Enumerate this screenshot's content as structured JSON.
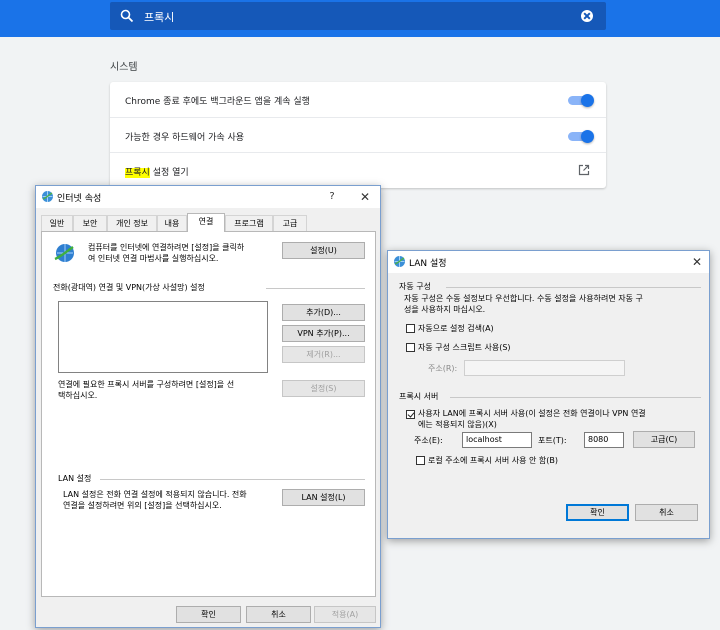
{
  "chrome": {
    "search_value": "프록시",
    "section_title": "시스템",
    "rows": [
      {
        "label": "Chrome 종료 후에도 백그라운드 앱을 계속 실행",
        "enabled": true
      },
      {
        "label": "가능한 경우 하드웨어 가속 사용",
        "enabled": true
      }
    ],
    "proxy_highlight": "프록시",
    "proxy_rest": " 설정 열기",
    "accent": "#1a73e8"
  },
  "inet": {
    "title": "인터넷 속성",
    "help": "?",
    "close": "✕",
    "tabs": [
      "일반",
      "보안",
      "개인 정보",
      "내용",
      "연결",
      "프로그램",
      "고급"
    ],
    "active_tab": "연결",
    "setup_text_1": "컴퓨터를 인터넷에 연결하려면 [설정]을 클릭하",
    "setup_text_2": "여 인터넷 연결 마법사를 실행하십시오.",
    "setup_button": "설정(U)",
    "dialup_header": "전화(광대역) 연결 및 VPN(가상 사설망) 설정",
    "add_button": "추가(D)...",
    "vpn_add_button": "VPN 추가(P)...",
    "remove_button": "제거(R)...",
    "proxy_text_1": "연결에 필요한 프록시 서버를 구성하려면 [설정]을 선",
    "proxy_text_2": "택하십시오.",
    "settings_button": "설정(S)",
    "lan_header": "LAN 설정",
    "lan_text_1": "LAN 설정은 전화 연결 설정에 적용되지 않습니다. 전화",
    "lan_text_2": "연결을 설정하려면 위의 [설정]을 선택하십시오.",
    "lan_button": "LAN 설정(L)",
    "ok": "확인",
    "cancel": "취소",
    "apply": "적용(A)"
  },
  "lan": {
    "title": "LAN 설정",
    "close": "✕",
    "auto_header": "자동 구성",
    "auto_text_1": "자동 구성은 수동 설정보다 우선합니다. 수동 설정을 사용하려면 자동 구",
    "auto_text_2": "성을 사용하지 마십시오.",
    "auto_detect": "자동으로 설정 검색(A)",
    "auto_script": "자동 구성 스크립트 사용(S)",
    "address_label": "주소(R):",
    "proxy_header": "프록시 서버",
    "use_proxy_1": "사용자 LAN에 프록시 서버 사용(이 설정은 전화 연결이나 VPN 연결",
    "use_proxy_2": "에는 적용되지 않음)(X)",
    "proxy_address_label": "주소(E):",
    "proxy_address": "localhost",
    "port_label": "포트(T):",
    "port": "8080",
    "advanced_button": "고급(C)",
    "bypass_local": "로컬 주소에 프록시 서버 사용 안 함(B)",
    "ok": "확인",
    "cancel": "취소"
  }
}
